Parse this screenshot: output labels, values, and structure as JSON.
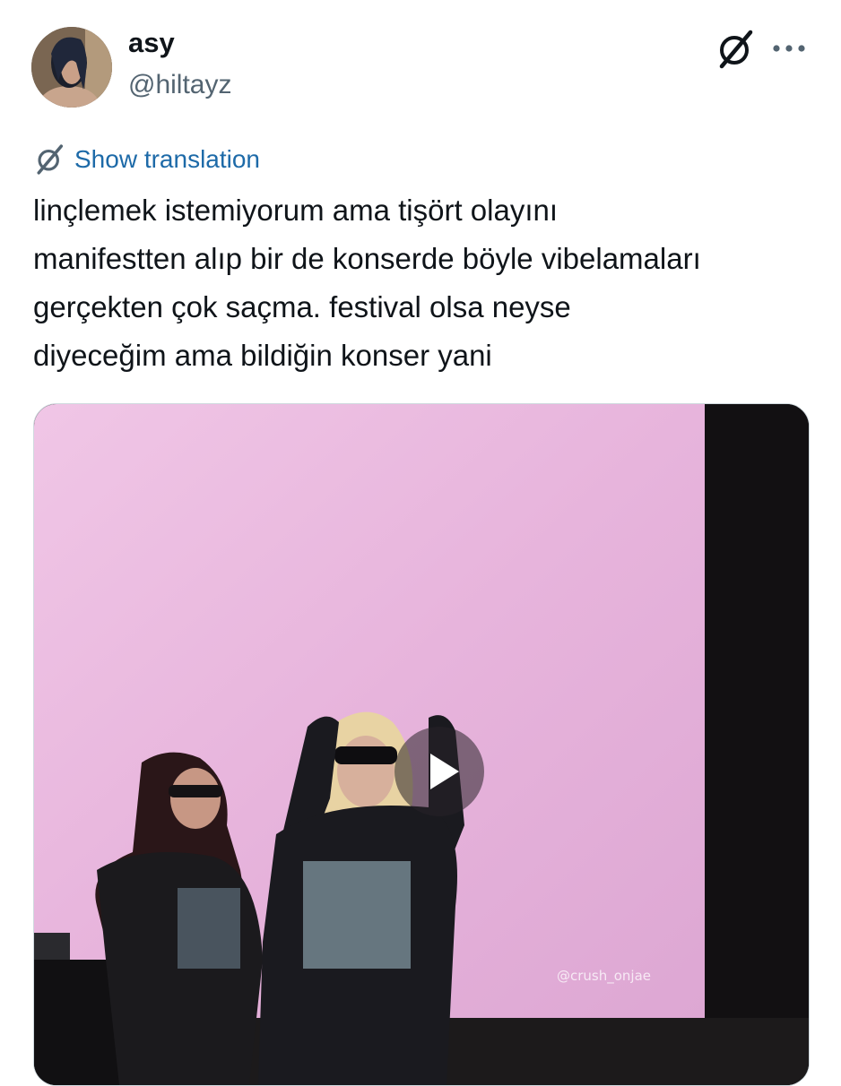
{
  "author": {
    "display_name": "asy",
    "handle": "@hiltayz"
  },
  "actions": {
    "grok_icon": "grok-icon",
    "more_icon": "more-icon"
  },
  "translate": {
    "label": "Show translation",
    "icon": "grok-icon"
  },
  "tweet": {
    "lines": [
      "linçlemek istemiyorum ama tişört olayını",
      "manifestten alıp bir de konserde böyle vibelamaları",
      "gerçekten çok saçma. festival olsa neyse",
      "diyeceğim ama bildiğin konser yani"
    ]
  },
  "media": {
    "type": "video",
    "watermark": "@crush_onjae"
  },
  "colors": {
    "link": "#1d6aa8",
    "secondary_text": "#536471",
    "screen_pink": "#e8b6dc"
  }
}
